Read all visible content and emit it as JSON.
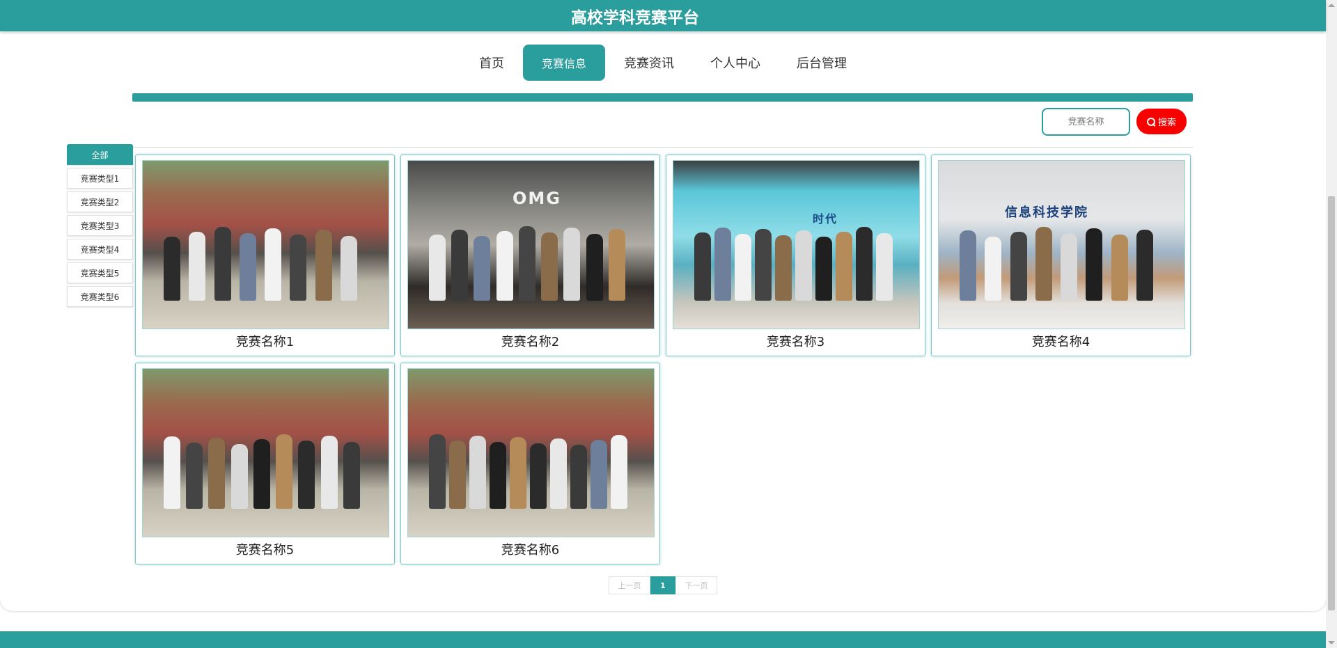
{
  "site": {
    "title": "高校学科竞赛平台"
  },
  "nav": {
    "items": [
      {
        "label": "首页",
        "active": false
      },
      {
        "label": "竞赛信息",
        "active": true
      },
      {
        "label": "竞赛资讯",
        "active": false
      },
      {
        "label": "个人中心",
        "active": false
      },
      {
        "label": "后台管理",
        "active": false
      }
    ]
  },
  "search": {
    "placeholder": "竞赛名称",
    "button_label": "搜索"
  },
  "categories": [
    {
      "label": "全部",
      "active": true
    },
    {
      "label": "竞赛类型1",
      "active": false
    },
    {
      "label": "竞赛类型2",
      "active": false
    },
    {
      "label": "竞赛类型3",
      "active": false
    },
    {
      "label": "竞赛类型4",
      "active": false
    },
    {
      "label": "竞赛类型5",
      "active": false
    },
    {
      "label": "竞赛类型6",
      "active": false
    }
  ],
  "competitions": [
    {
      "name": "竞赛名称1",
      "photo": "group-photo-temple"
    },
    {
      "name": "竞赛名称2",
      "photo": "group-photo-escape-room"
    },
    {
      "name": "竞赛名称3",
      "photo": "group-photo-stage"
    },
    {
      "name": "竞赛名称4",
      "photo": "group-photo-hall"
    },
    {
      "name": "竞赛名称5",
      "photo": "group-photo-temple"
    },
    {
      "name": "竞赛名称6",
      "photo": "group-photo-temple"
    }
  ],
  "photo_texts": {
    "room_sign": "OMG",
    "stage_banner": "时代",
    "hall_sign": "信息科技学院"
  },
  "pagination": {
    "prev_label": "上一页",
    "current_page": "1",
    "next_label": "下一页"
  },
  "colors": {
    "accent": "#2a9d9d",
    "search_button": "#f80000"
  }
}
